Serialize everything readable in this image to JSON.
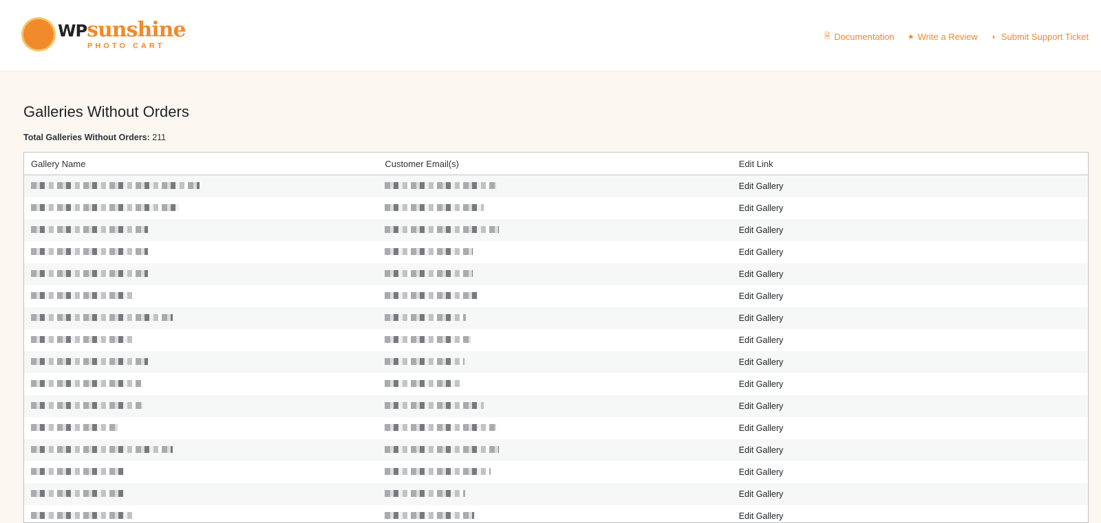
{
  "header": {
    "logo_wp": "WP",
    "logo_sunshine": "sunshine",
    "logo_sub": "PHOTO CART",
    "links": [
      {
        "label": "Documentation",
        "icon": "document-icon"
      },
      {
        "label": "Write a Review",
        "icon": "star-icon"
      },
      {
        "label": "Submit Support Ticket",
        "icon": "support-icon"
      }
    ]
  },
  "page": {
    "title": "Galleries Without Orders",
    "total_label": "Total Galleries Without Orders:",
    "total_value": "211"
  },
  "table": {
    "columns": [
      "Gallery Name",
      "Customer Email(s)",
      "Edit Link"
    ],
    "rows": [
      {
        "edit": "Edit Gallery"
      },
      {
        "edit": "Edit Gallery"
      },
      {
        "edit": "Edit Gallery"
      },
      {
        "edit": "Edit Gallery"
      },
      {
        "edit": "Edit Gallery"
      },
      {
        "edit": "Edit Gallery"
      },
      {
        "edit": "Edit Gallery"
      },
      {
        "edit": "Edit Gallery"
      },
      {
        "edit": "Edit Gallery"
      },
      {
        "edit": "Edit Gallery"
      },
      {
        "edit": "Edit Gallery"
      },
      {
        "edit": "Edit Gallery"
      },
      {
        "edit": "Edit Gallery"
      },
      {
        "edit": "Edit Gallery"
      },
      {
        "edit": "Edit Gallery"
      },
      {
        "edit": "Edit Gallery"
      }
    ]
  },
  "colors": {
    "accent": "#ef8a2b",
    "page_bg": "#fcf7f1"
  }
}
